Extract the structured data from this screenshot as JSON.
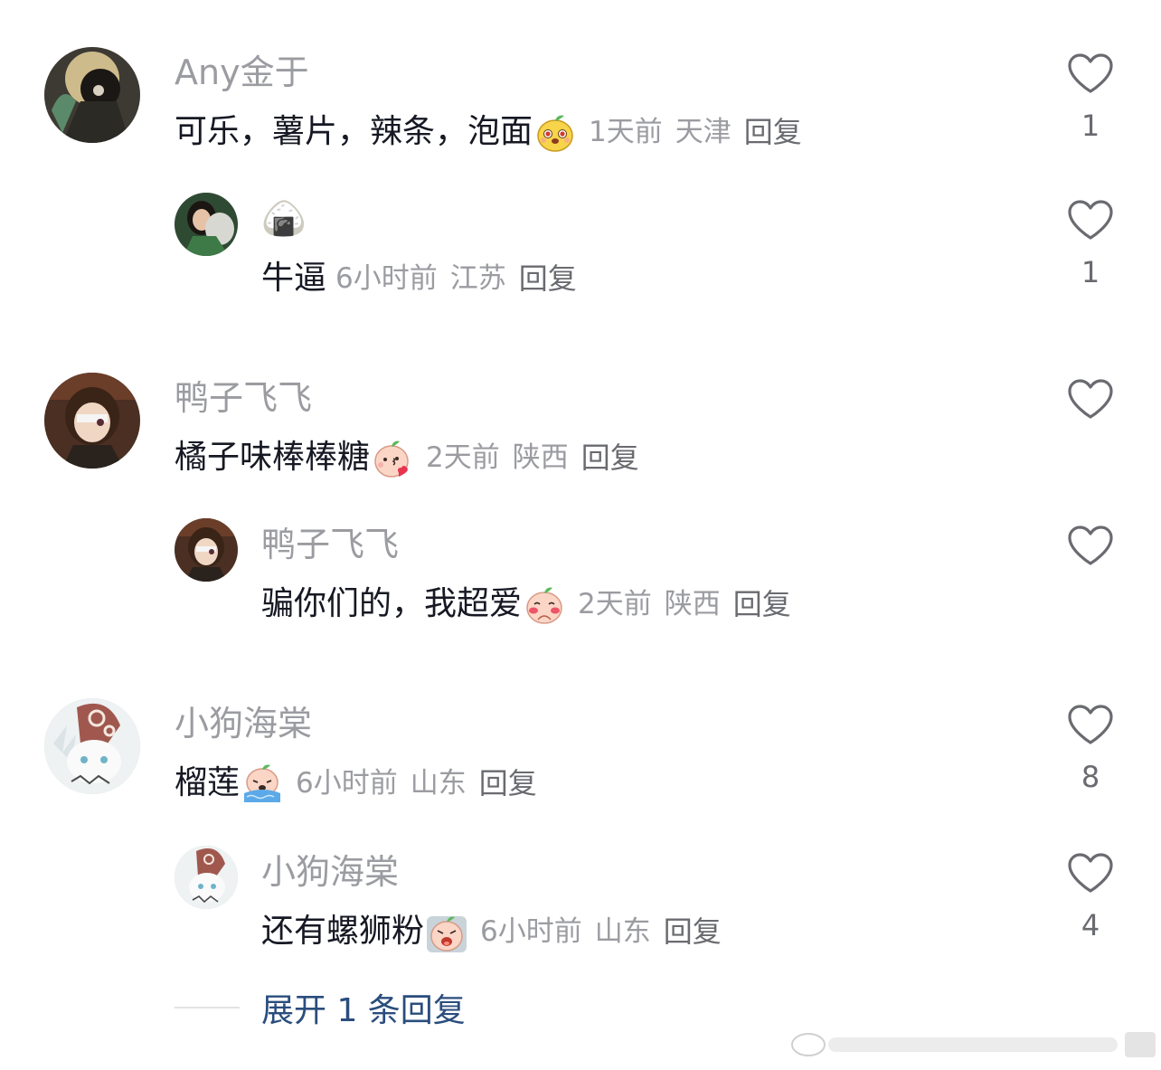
{
  "comments": [
    {
      "username": "Any金于",
      "text": "可乐，薯片，辣条，泡面",
      "emoji": "happy-sprout-emoji",
      "time": "1天前",
      "location": "天津",
      "reply_label": "回复",
      "likes": "1",
      "replies": [
        {
          "username": "🍙",
          "text": "牛逼",
          "time": "6小时前",
          "location": "江苏",
          "reply_label": "回复",
          "likes": "1"
        }
      ]
    },
    {
      "username": "鸭子飞飞",
      "text": "橘子味棒棒糖",
      "emoji": "kiss-sprout-emoji",
      "time": "2天前",
      "location": "陕西",
      "reply_label": "回复",
      "likes": "",
      "replies": [
        {
          "username": "鸭子飞飞",
          "text": "骗你们的，我超爱",
          "emoji": "shy-sprout-emoji",
          "time": "2天前",
          "location": "陕西",
          "reply_label": "回复",
          "likes": ""
        }
      ]
    },
    {
      "username": "小狗海棠",
      "text": "榴莲",
      "emoji": "crying-sprout-emoji",
      "time": "6小时前",
      "location": "山东",
      "reply_label": "回复",
      "likes": "8",
      "replies": [
        {
          "username": "小狗海棠",
          "text": "还有螺狮粉",
          "emoji": "scream-sprout-emoji",
          "time": "6小时前",
          "location": "山东",
          "reply_label": "回复",
          "likes": "4"
        }
      ]
    }
  ],
  "expand_replies_label": "展开 1 条回复",
  "colors": {
    "username": "#9b9ca1",
    "text": "#161823",
    "meta": "#9b9ca1",
    "expand_link": "#2a4d7d",
    "heart_outline": "#6a6b70"
  }
}
